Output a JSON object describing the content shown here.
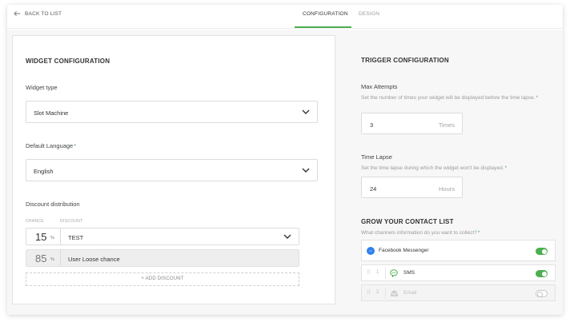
{
  "nav": {
    "back_label": "BACK TO LIST",
    "tabs": [
      {
        "label": "CONFIGURATION",
        "active": true
      },
      {
        "label": "DESIGN",
        "active": false
      }
    ]
  },
  "widget_config": {
    "title": "WIDGET CONFIGURATION",
    "widget_type_label": "Widget type",
    "widget_type_value": "Slot Machine",
    "language_label": "Default Language",
    "language_value": "English",
    "discount_label": "Discount distribution",
    "chance_header": "CHANCE",
    "discount_header": "DISCOUNT",
    "rows": [
      {
        "chance": "15",
        "pct": "%",
        "discount": "TEST"
      },
      {
        "chance": "85",
        "pct": "%",
        "discount": "User Loose chance"
      }
    ],
    "add_discount_label": "+ ADD DISCOUNT"
  },
  "trigger_config": {
    "title": "TRIGGER CONFIGURATION",
    "max_attempts_label": "Max Attempts",
    "max_attempts_hint": "Set the number of times your widget will be displayed before the time lapse.",
    "max_attempts_value": "3",
    "max_attempts_unit": "Times",
    "time_lapse_label": "Time Lapse",
    "time_lapse_hint": "Set the time lapse during which the widget won't be displayed.",
    "time_lapse_value": "24",
    "time_lapse_unit": "Hours"
  },
  "contact": {
    "title": "GROW YOUR CONTACT LIST",
    "hint": "What channels information do you want to collect?",
    "channels": [
      {
        "label": "Facebook Messenger",
        "enabled": true,
        "icon": "messenger-icon"
      },
      {
        "order": "1",
        "label": "SMS",
        "enabled": true,
        "icon": "sms-icon"
      },
      {
        "order": "2",
        "label": "Email",
        "enabled": false,
        "icon": "email-icon"
      }
    ]
  },
  "colors": {
    "accent": "#4caf50",
    "messenger": "#2f80ed"
  }
}
